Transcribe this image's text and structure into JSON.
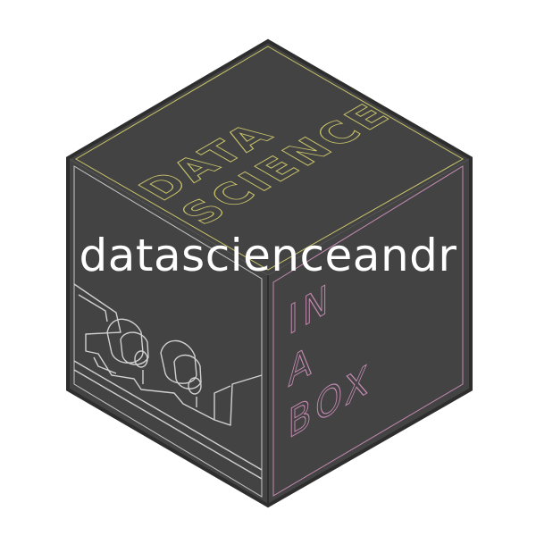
{
  "logo": {
    "top_face_text": [
      "DATA",
      "SCIENCE"
    ],
    "right_face_text": [
      "IN",
      "A",
      "BOX"
    ],
    "top_outline_color": "#c9c46a",
    "right_outline_color": "#c48ab2",
    "left_outline_color": "#d0d0d0",
    "cube_fill": "#434343",
    "cube_edge": "#2e2e2e"
  },
  "overlay": {
    "title": "datascienceandr",
    "color": "#ffffff"
  }
}
